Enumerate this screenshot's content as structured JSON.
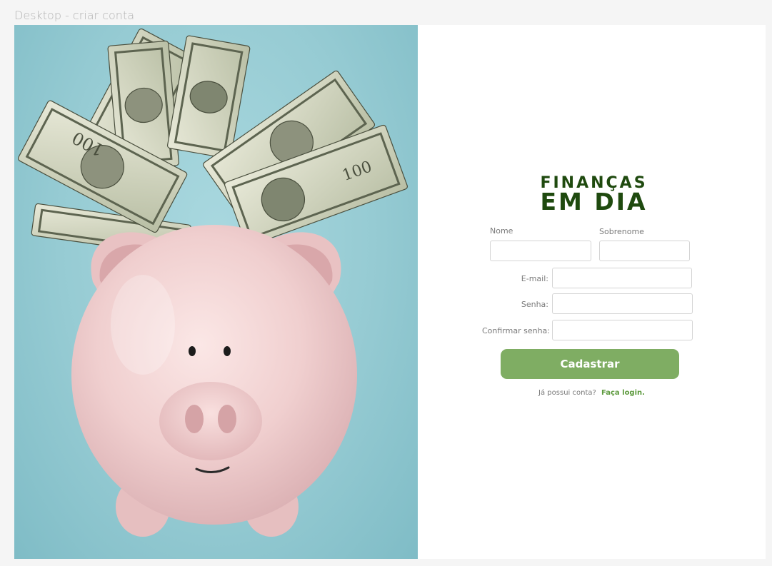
{
  "frame": {
    "label": "Desktop - criar conta"
  },
  "hero": {
    "image_description_icon": "piggy-bank-with-dollar-bills"
  },
  "brand": {
    "line1": "FINANÇAS",
    "line2": "EM DIA",
    "color": "#1f4a0f"
  },
  "form": {
    "first_name_label": "Nome",
    "last_name_label": "Sobrenome",
    "email_label": "E-mail:",
    "password_label": "Senha:",
    "confirm_password_label": "Confirmar senha:",
    "first_name_value": "",
    "last_name_value": "",
    "email_value": "",
    "password_value": "",
    "confirm_password_value": "",
    "submit_label": "Cadastrar",
    "submit_color": "#7fad63"
  },
  "login": {
    "prompt": "Já possui conta?",
    "link_label": "Faça login.",
    "link_color": "#5d9a3e"
  }
}
